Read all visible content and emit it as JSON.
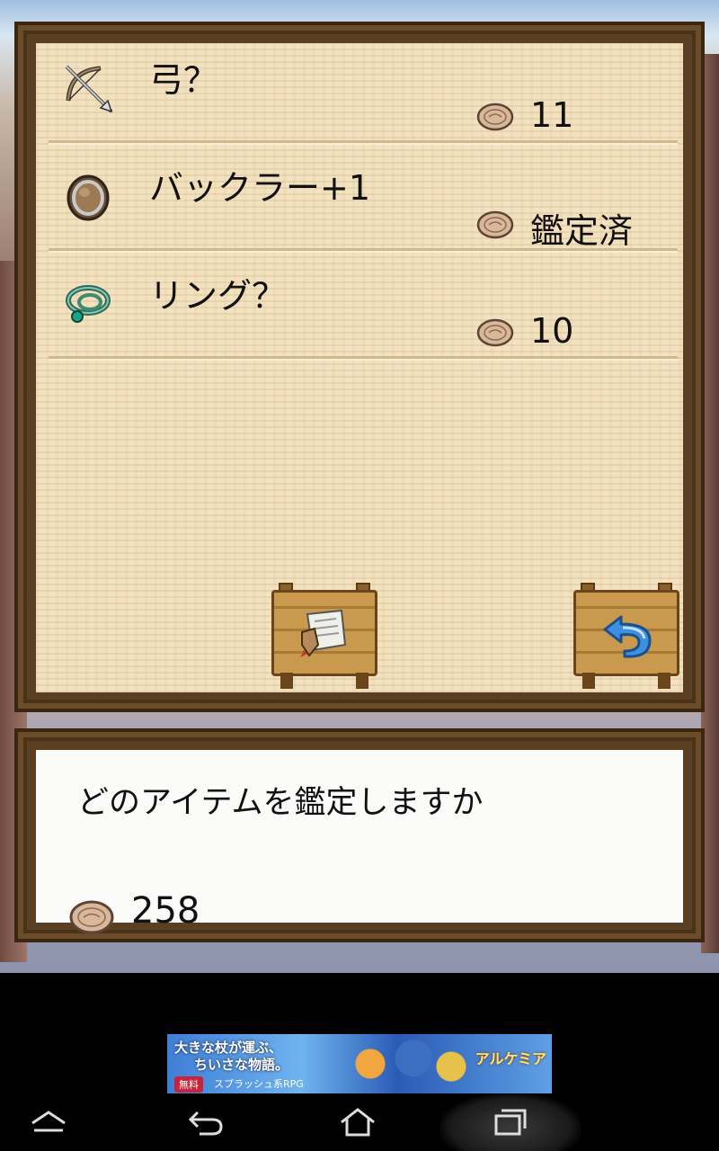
{
  "items": [
    {
      "name": "弓？",
      "price": "11",
      "icon": "bow-icon"
    },
    {
      "name": "バックラー+1",
      "price": "鑑定済",
      "icon": "buckler-icon"
    },
    {
      "name": "リング？",
      "price": "10",
      "icon": "ring-icon"
    }
  ],
  "buttons": {
    "appraise_icon": "scroll-icon",
    "back_icon": "back-arrow-icon"
  },
  "message": {
    "text": "どのアイテムを鑑定しますか",
    "money": "258"
  },
  "ad": {
    "line1": "大きな杖が運ぶ、",
    "line2": "ちいさな物語。",
    "badge": "無料",
    "tag": "スプラッシュ系RPG",
    "logo": "アルケミア"
  },
  "navbar": {
    "icons": [
      "home-up-icon",
      "back-icon",
      "home-icon",
      "recent-apps-icon"
    ]
  },
  "colors": {
    "frame": "#5a3f22",
    "parchment": "#f3e2c0",
    "text": "#111111"
  }
}
